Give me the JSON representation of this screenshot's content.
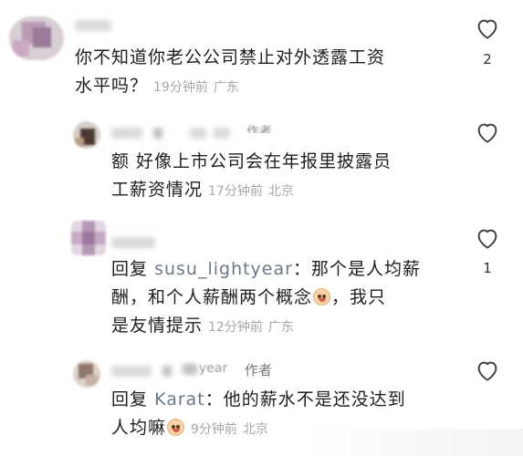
{
  "comments": [
    {
      "text_lines": [
        "你不知道你老公公司禁止对外透露工资",
        "水平吗？"
      ],
      "time": "19分钟前",
      "location": "广东",
      "likes": "2"
    },
    {
      "author_tag": "作者",
      "text_lines": [
        "额 好像上市公司会在年报里披露员",
        "工薪资情况"
      ],
      "time": "17分钟前",
      "location": "北京",
      "likes": ""
    },
    {
      "reply_prefix": "回复",
      "reply_to": "susu_lightyear",
      "text_line1_rest": "：那个是人均薪",
      "text_line2": "酬，和个人薪酬两个概念",
      "text_line2_tail": "，我只",
      "text_line3": "是友情提示",
      "time": "12分钟前",
      "location": "广东",
      "likes": "1"
    },
    {
      "name_tail": "year",
      "author_tag": "作者",
      "reply_prefix": "回复",
      "reply_to": "Karat",
      "text_line1_rest": "：他的薪水不是还没达到",
      "text_line2": "人均嘛",
      "time": "9分钟前",
      "location": "北京",
      "likes": ""
    }
  ],
  "icons": {
    "like": "heart-outline-icon",
    "emoji": "crying-face-icon"
  }
}
